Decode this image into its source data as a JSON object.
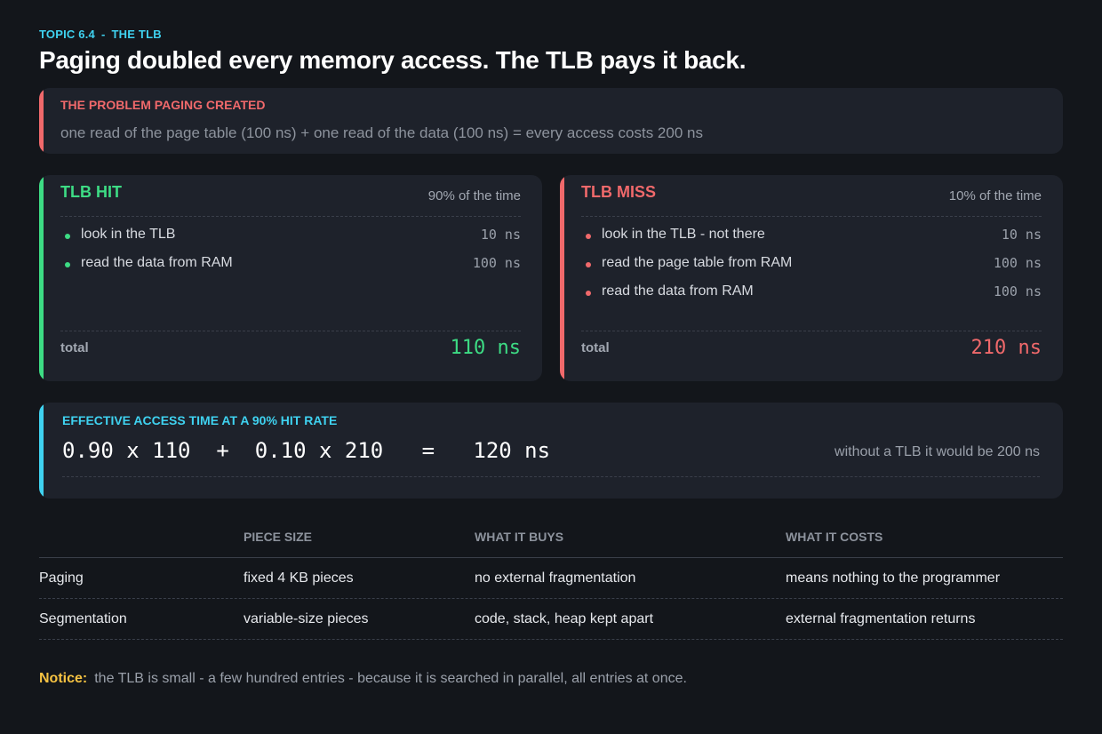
{
  "topic": {
    "number": "TOPIC 6.4",
    "separator": "-",
    "name": "THE TLB"
  },
  "title": "Paging doubled every memory access. The TLB pays it back.",
  "problem": {
    "label": "THE PROBLEM PAGING CREATED",
    "text": "one read of the page table (100 ns) + one read of the data (100 ns)  =  every access costs 200 ns"
  },
  "hit": {
    "title": "TLB HIT",
    "frequency": "90% of the time",
    "steps": [
      {
        "label": "look in the TLB",
        "cost": "10 ns"
      },
      {
        "label": "read the data from RAM",
        "cost": "100 ns"
      }
    ],
    "total_label": "total",
    "total_value": "110 ns"
  },
  "miss": {
    "title": "TLB MISS",
    "frequency": "10% of the time",
    "steps": [
      {
        "label": "look in the TLB - not there",
        "cost": "10 ns"
      },
      {
        "label": "read the page table from RAM",
        "cost": "100 ns"
      },
      {
        "label": "read the data from RAM",
        "cost": "100 ns"
      }
    ],
    "total_label": "total",
    "total_value": "210 ns"
  },
  "effective": {
    "label": "EFFECTIVE ACCESS TIME AT A 90% HIT RATE",
    "formula": "0.90 x 110  +  0.10 x 210   =   120 ns",
    "note": "without a TLB it would be 200 ns"
  },
  "comparison": {
    "headers": [
      "",
      "PIECE SIZE",
      "WHAT IT BUYS",
      "WHAT IT COSTS"
    ],
    "rows": [
      [
        "Paging",
        "fixed 4 KB pieces",
        "no external fragmentation",
        "means nothing to the programmer"
      ],
      [
        "Segmentation",
        "variable-size pieces",
        "code, stack, heap kept apart",
        "external fragmentation returns"
      ]
    ]
  },
  "notice": {
    "label": "Notice:",
    "text": "the TLB is small - a few hundred entries - because it is searched in parallel, all entries at once."
  },
  "colors": {
    "background": "#13161b",
    "card": "#1e222b",
    "accent_cyan": "#3fd2f0",
    "accent_red": "#f0696b",
    "accent_green": "#3ddc84",
    "notice_yellow": "#f5c242"
  }
}
